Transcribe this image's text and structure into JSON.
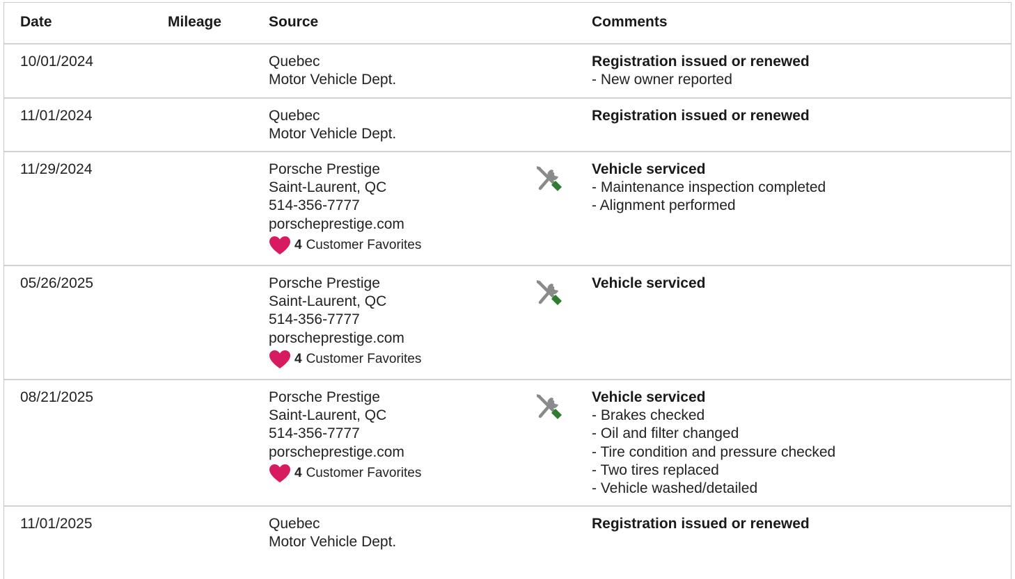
{
  "table": {
    "headers": {
      "date": "Date",
      "mileage": "Mileage",
      "source": "Source",
      "comments": "Comments"
    },
    "rows": [
      {
        "date": "10/01/2024",
        "mileage": "",
        "source": [
          "Quebec",
          "Motor Vehicle Dept."
        ],
        "favorites": null,
        "icon": null,
        "comment_title": "Registration issued or renewed",
        "comment_items": [
          "- New owner reported"
        ]
      },
      {
        "date": "11/01/2024",
        "mileage": "",
        "source": [
          "Quebec",
          "Motor Vehicle Dept."
        ],
        "favorites": null,
        "icon": null,
        "comment_title": "Registration issued or renewed",
        "comment_items": []
      },
      {
        "date": "11/29/2024",
        "mileage": "",
        "source": [
          "Porsche Prestige",
          "Saint-Laurent, QC",
          "514-356-7777",
          "porscheprestige.com"
        ],
        "favorites": {
          "count": "4",
          "label": "Customer Favorites"
        },
        "icon": "service-tools-icon",
        "comment_title": "Vehicle serviced",
        "comment_items": [
          "- Maintenance inspection completed",
          "- Alignment performed"
        ]
      },
      {
        "date": "05/26/2025",
        "mileage": "",
        "source": [
          "Porsche Prestige",
          "Saint-Laurent, QC",
          "514-356-7777",
          "porscheprestige.com"
        ],
        "favorites": {
          "count": "4",
          "label": "Customer Favorites"
        },
        "icon": "service-tools-icon",
        "comment_title": "Vehicle serviced",
        "comment_items": []
      },
      {
        "date": "08/21/2025",
        "mileage": "",
        "source": [
          "Porsche Prestige",
          "Saint-Laurent, QC",
          "514-356-7777",
          "porscheprestige.com"
        ],
        "favorites": {
          "count": "4",
          "label": "Customer Favorites"
        },
        "icon": "service-tools-icon",
        "comment_title": "Vehicle serviced",
        "comment_items": [
          "- Brakes checked",
          "- Oil and filter changed",
          "- Tire condition and pressure checked",
          "- Two tires replaced",
          "- Vehicle washed/detailed"
        ]
      },
      {
        "date": "11/01/2025",
        "mileage": "",
        "source": [
          "Quebec",
          "Motor Vehicle Dept."
        ],
        "favorites": null,
        "icon": null,
        "comment_title": "Registration issued or renewed",
        "comment_items": []
      }
    ]
  },
  "colors": {
    "heart": "#d81b60",
    "wrench": "#8a8a8a",
    "screwdriver_handle": "#2e7d32",
    "row_border": "#d2d2d2"
  }
}
